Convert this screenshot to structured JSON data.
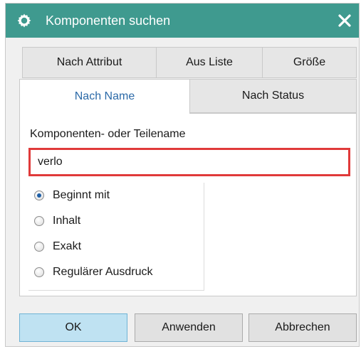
{
  "dialog": {
    "title": "Komponenten suchen",
    "title_icon": "gear-icon",
    "close_icon": "close-icon",
    "titlebar_color": "#3f9a8f"
  },
  "tabs": {
    "row1": [
      {
        "label": "Nach Attribut"
      },
      {
        "label": "Aus Liste"
      },
      {
        "label": "Größe"
      }
    ],
    "row2": [
      {
        "label": "Nach Name",
        "active": true
      },
      {
        "label": "Nach Status",
        "active": false
      }
    ]
  },
  "panel": {
    "field_label": "Komponenten- oder Teilename",
    "input_value": "verlo",
    "options": [
      {
        "label": "Beginnt mit",
        "checked": true
      },
      {
        "label": "Inhalt",
        "checked": false
      },
      {
        "label": "Exakt",
        "checked": false
      },
      {
        "label": "Regulärer Ausdruck",
        "checked": false
      }
    ]
  },
  "buttons": {
    "ok": "OK",
    "apply": "Anwenden",
    "cancel": "Abbrechen"
  }
}
